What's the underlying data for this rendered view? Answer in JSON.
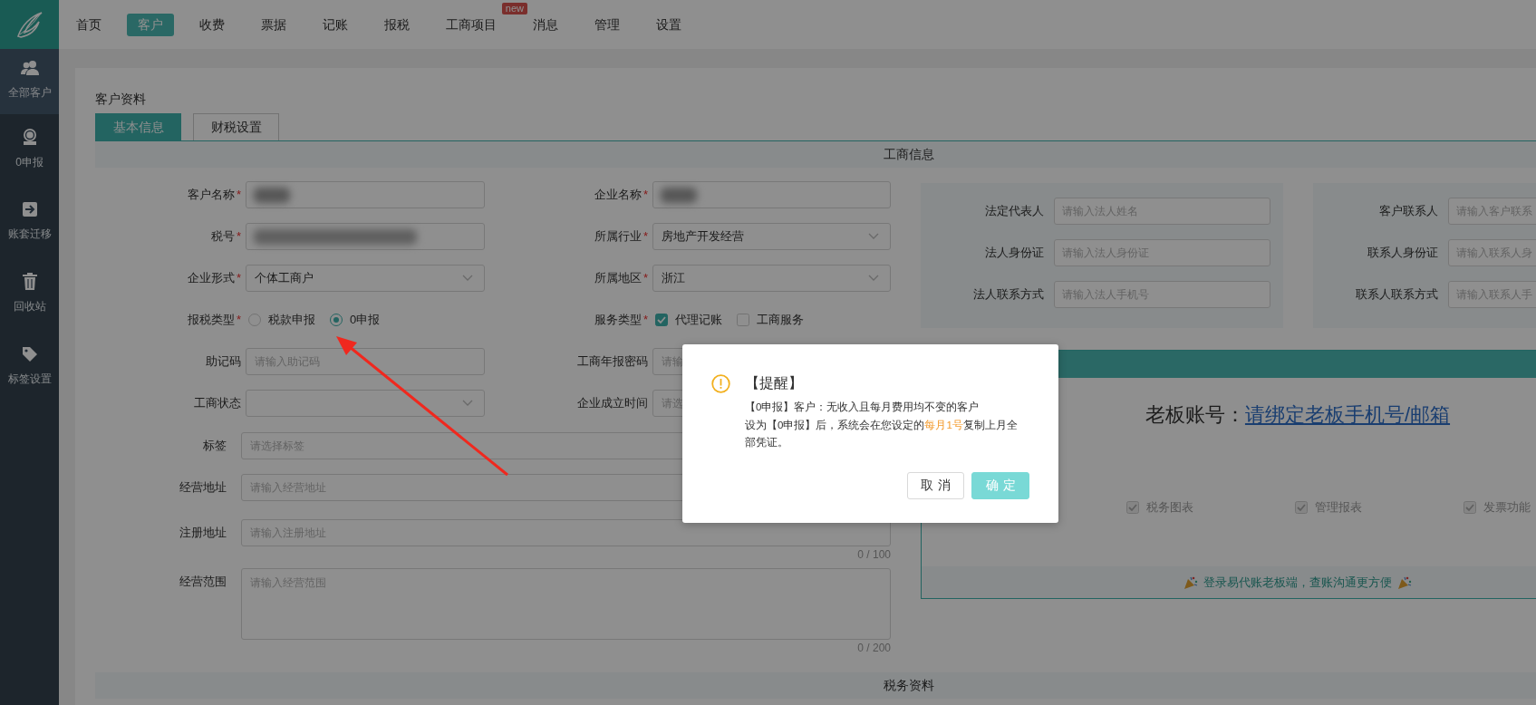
{
  "top_nav": {
    "items": [
      {
        "label": "首页",
        "selected": false
      },
      {
        "label": "客户",
        "selected": true
      },
      {
        "label": "收费",
        "selected": false
      },
      {
        "label": "票据",
        "selected": false
      },
      {
        "label": "记账",
        "selected": false
      },
      {
        "label": "报税",
        "selected": false
      },
      {
        "label": "工商项目",
        "selected": false,
        "badge": "new"
      },
      {
        "label": "消息",
        "selected": false
      },
      {
        "label": "管理",
        "selected": false
      },
      {
        "label": "设置",
        "selected": false
      }
    ]
  },
  "sidebar": {
    "items": [
      {
        "label": "全部客户",
        "selected": true
      },
      {
        "label": "0申报",
        "selected": false
      },
      {
        "label": "账套迁移",
        "selected": false
      },
      {
        "label": "回收站",
        "selected": false
      },
      {
        "label": "标签设置",
        "selected": false
      }
    ]
  },
  "page": {
    "title": "客户资料",
    "tabs": [
      {
        "label": "基本信息",
        "selected": true
      },
      {
        "label": "财税设置",
        "selected": false
      }
    ]
  },
  "business_section": {
    "title": "工商信息",
    "fields": [
      {
        "label": "客户名称",
        "required_mark": "*",
        "kind": "text",
        "redacted": true
      },
      {
        "label": "企业名称",
        "required_mark": "*",
        "kind": "text",
        "redacted": true
      },
      {
        "label": "税号",
        "required_mark": "*",
        "kind": "text",
        "redacted": true
      },
      {
        "label": "所属行业",
        "required_mark": "*",
        "kind": "select",
        "value": "房地产开发经营"
      },
      {
        "label": "企业形式",
        "required_mark": "*",
        "kind": "select",
        "value": "个体工商户"
      },
      {
        "label": "所属地区",
        "required_mark": "*",
        "kind": "select",
        "value": "浙江"
      },
      {
        "label": "报税类型",
        "required_mark": "*",
        "kind": "radio",
        "options": [
          {
            "label": "税款申报",
            "selected": false
          },
          {
            "label": "0申报",
            "selected": true
          }
        ]
      },
      {
        "label": "服务类型",
        "required_mark": "*",
        "kind": "checkbox",
        "options": [
          {
            "label": "代理记账",
            "checked": true
          },
          {
            "label": "工商服务",
            "checked": false
          }
        ]
      },
      {
        "label": "助记码",
        "kind": "text",
        "placeholder": "请输入助记码"
      },
      {
        "label": "工商年报密码",
        "kind": "text",
        "placeholder": "请输"
      },
      {
        "label": "工商状态",
        "kind": "select"
      },
      {
        "label": "企业成立时间",
        "kind": "text",
        "placeholder": "请选"
      }
    ],
    "wide_fields": [
      {
        "label": "标签",
        "kind": "text",
        "placeholder": "请选择标签"
      },
      {
        "label": "经营地址",
        "kind": "text",
        "placeholder": "请输入经营地址"
      },
      {
        "label": "注册地址",
        "kind": "text",
        "placeholder": "请输入注册地址",
        "counter": "0 / 100"
      },
      {
        "label": "经营范围",
        "kind": "textarea",
        "placeholder": "请输入经营范围",
        "counter": "0 / 200"
      }
    ],
    "legal_person": [
      {
        "label": "法定代表人",
        "placeholder": "请输入法人姓名"
      },
      {
        "label": "法人身份证",
        "placeholder": "请输入法人身份证"
      },
      {
        "label": "法人联系方式",
        "placeholder": "请输入法人手机号"
      }
    ],
    "contact_person": [
      {
        "label": "客户联系人",
        "placeholder": "请输入客户联系"
      },
      {
        "label": "联系人身份证",
        "placeholder": "请输入联系人身"
      },
      {
        "label": "联系人联系方式",
        "placeholder": "请输入联系人手"
      }
    ],
    "boss_account": {
      "label": "老板账号：",
      "link": "请绑定老板手机号/邮箱",
      "features": [
        {
          "label": "税务图表",
          "checked": true
        },
        {
          "label": "管理报表",
          "checked": true
        },
        {
          "label": "发票功能",
          "checked": true
        }
      ],
      "footer": "登录易代账老板端，查账沟通更方便"
    }
  },
  "tax_section": {
    "title": "税务资料"
  },
  "dialog": {
    "title": "【提醒】",
    "line_1": "【0申报】客户：无收入且每月费用均不变的客户",
    "line_2": {
      "before": "设为【0申报】后，系统会在您设定的",
      "highlight": "每月1号",
      "after": "复制上月全部凭证。"
    },
    "buttons": [
      {
        "label": "取消",
        "kind": "secondary"
      },
      {
        "label": "确定",
        "kind": "primary"
      }
    ]
  }
}
